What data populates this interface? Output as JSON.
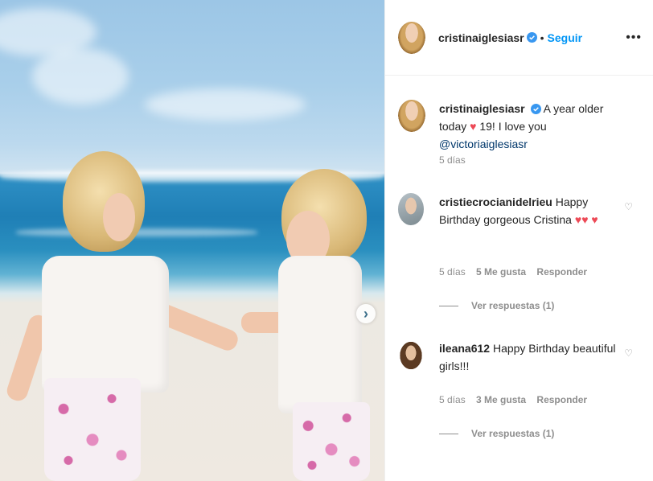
{
  "post": {
    "author": "cristinaiglesiasr",
    "follow_label": "Seguir",
    "separator": "•",
    "more_label": "•••",
    "next_label": "›"
  },
  "caption": {
    "user": "cristinaiglesiasr",
    "text_before": "A year older today",
    "heart": "♥",
    "text_after": "19! I love you",
    "mention": "@victoriaiglesiasr",
    "time": "5 días"
  },
  "comments": [
    {
      "user": "cristiecrocianidelrieu",
      "text": "Happy Birthday gorgeous Cristina",
      "hearts": "♥♥",
      "hearts2": "♥",
      "time": "5 días",
      "likes": "5 Me gusta",
      "reply_label": "Responder",
      "view_replies": "Ver respuestas (1)",
      "like_icon": "♡"
    },
    {
      "user": "ileana612",
      "text": "Happy Birthday beautiful girls!!!",
      "time": "5 días",
      "likes": "3 Me gusta",
      "reply_label": "Responder",
      "view_replies": "Ver respuestas (1)",
      "like_icon": "♡"
    }
  ],
  "colors": {
    "link": "#0095f6",
    "verified": "#3897f0",
    "heart": "#ed4956",
    "muted": "#8e8e8e"
  }
}
